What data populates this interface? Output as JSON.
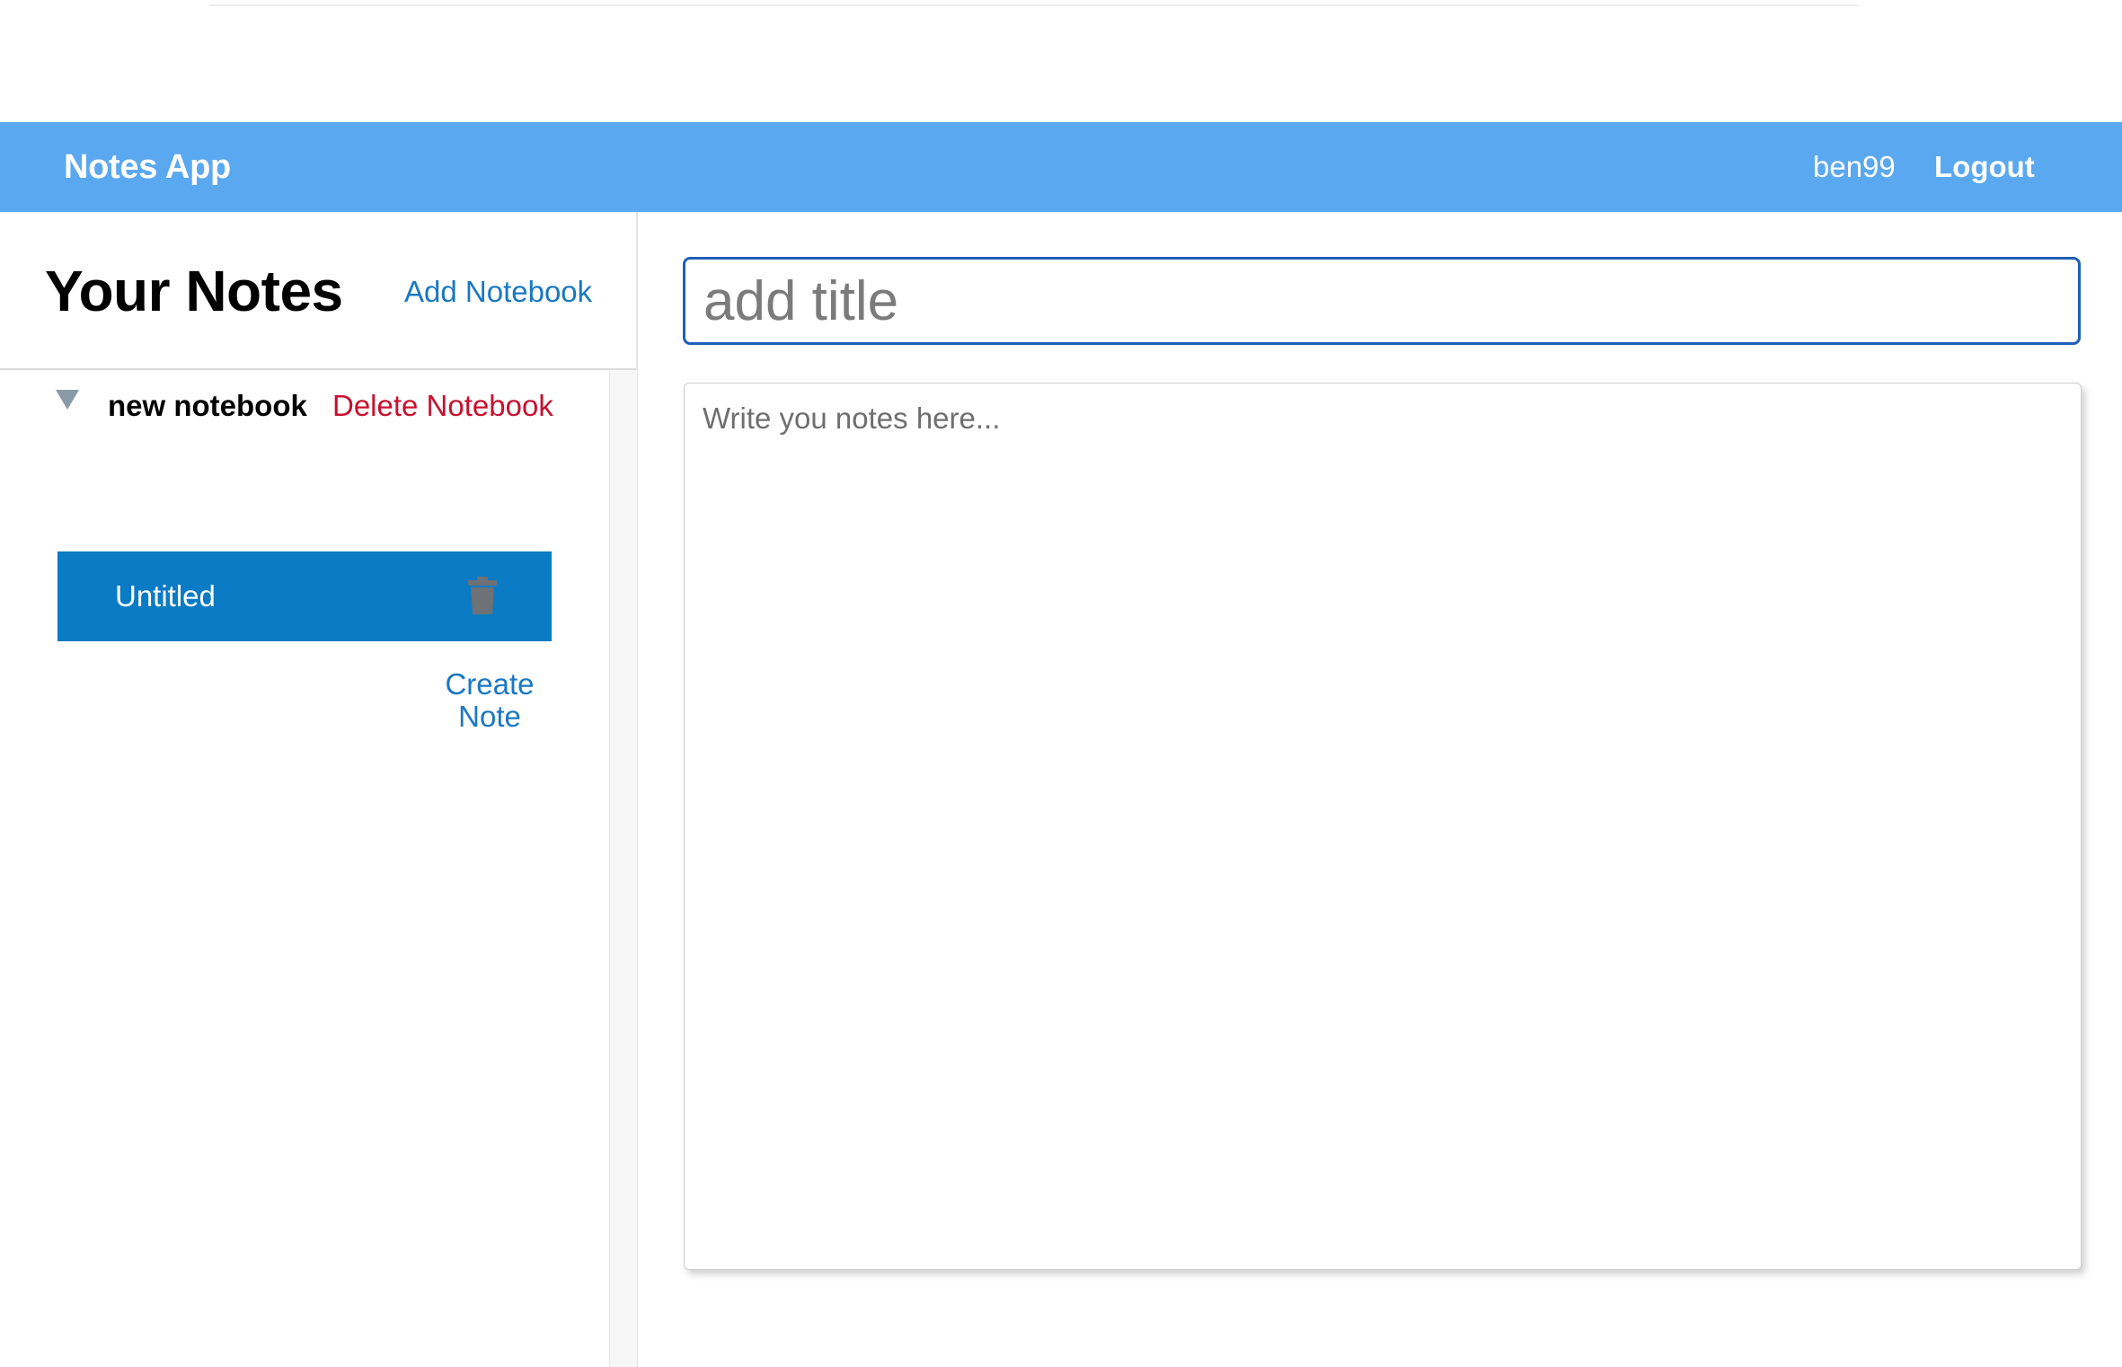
{
  "navbar": {
    "brand": "Notes App",
    "username": "ben99",
    "logout_label": "Logout"
  },
  "sidebar": {
    "title": "Your Notes",
    "add_notebook_label": "Add Notebook",
    "notebooks": [
      {
        "name": "new notebook",
        "delete_label": "Delete Notebook",
        "expanded": true,
        "notes": [
          {
            "title": "Untitled",
            "selected": true
          }
        ],
        "create_note_label": "Create Note"
      }
    ]
  },
  "editor": {
    "title_value": "",
    "title_placeholder": "add title",
    "body_value": "",
    "body_placeholder": "Write you notes here..."
  },
  "icons": {
    "notebook_toggle": "triangle-down-icon",
    "note_delete": "trash-icon"
  },
  "colors": {
    "navbar_bg": "#5aa8ef",
    "selected_note_bg": "#0a7bc4",
    "link": "#1a78c2",
    "danger": "#c8102e",
    "focus_border": "#1f5fb8"
  }
}
